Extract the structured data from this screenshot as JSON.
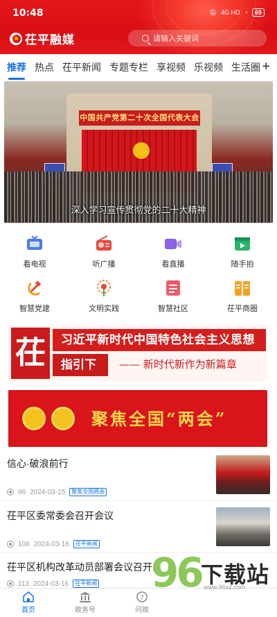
{
  "status_bar": {
    "time": "10:48",
    "network": "4G HD",
    "battery": "69"
  },
  "header": {
    "brand": "茌平融媒",
    "search_placeholder": "请输入关键词",
    "accent": "#e5161b"
  },
  "tabs": [
    {
      "label": "推荐",
      "active": true
    },
    {
      "label": "热点"
    },
    {
      "label": "茌平新闻"
    },
    {
      "label": "专题专栏"
    },
    {
      "label": "享视频"
    },
    {
      "label": "乐视频"
    },
    {
      "label": "生活圈"
    }
  ],
  "tabs_more": "+",
  "hero": {
    "banner_text": "中国共产党第二十次全国代表大会",
    "caption": "深入学习宣传贯彻党的二十大精神"
  },
  "shortcuts": [
    {
      "label": "看电视",
      "icon": "tv-icon",
      "color": "#4a7be8"
    },
    {
      "label": "听广播",
      "icon": "radio-icon",
      "color": "#e8473b"
    },
    {
      "label": "看直播",
      "icon": "video-icon",
      "color": "#8b63e6"
    },
    {
      "label": "随手拍",
      "icon": "clapper-icon",
      "color": "#27b36b"
    },
    {
      "label": "智慧党建",
      "icon": "party-emblem-icon",
      "color": "#e8473b"
    },
    {
      "label": "文明实践",
      "icon": "flower-icon",
      "color": "#f08a2c"
    },
    {
      "label": "智慧社区",
      "icon": "community-doc-icon",
      "color": "#f05a6a"
    },
    {
      "label": "茌平商圈",
      "icon": "book-icon",
      "color": "#f3a324"
    }
  ],
  "banner1": {
    "badge": "茌",
    "line1": "习近平新时代中国特色社会主义思想",
    "line2": "指引下",
    "slogan": "—— 新时代新作为新篇章"
  },
  "banner2": {
    "title": "聚焦全国“两会”"
  },
  "news": [
    {
      "title": "信心·破浪前行",
      "views": "96",
      "date": "2024-03-15",
      "tag": "聚焦全国两会"
    },
    {
      "title": "茌平区委常委会召开会议",
      "views": "106",
      "date": "2024-03-16",
      "tag": "茌平新闻"
    },
    {
      "title": "茌平区机构改革动员部署会议召开",
      "views": "113",
      "date": "2024-03-16",
      "tag": "茌平新闻"
    }
  ],
  "bottom_nav": [
    {
      "label": "首页",
      "icon": "home-icon",
      "active": true
    },
    {
      "label": "政务号",
      "icon": "government-icon"
    },
    {
      "label": "问政",
      "icon": "question-icon"
    }
  ],
  "watermark": {
    "number": "96",
    "text": "下载站",
    "url": "www.96xz.com"
  }
}
